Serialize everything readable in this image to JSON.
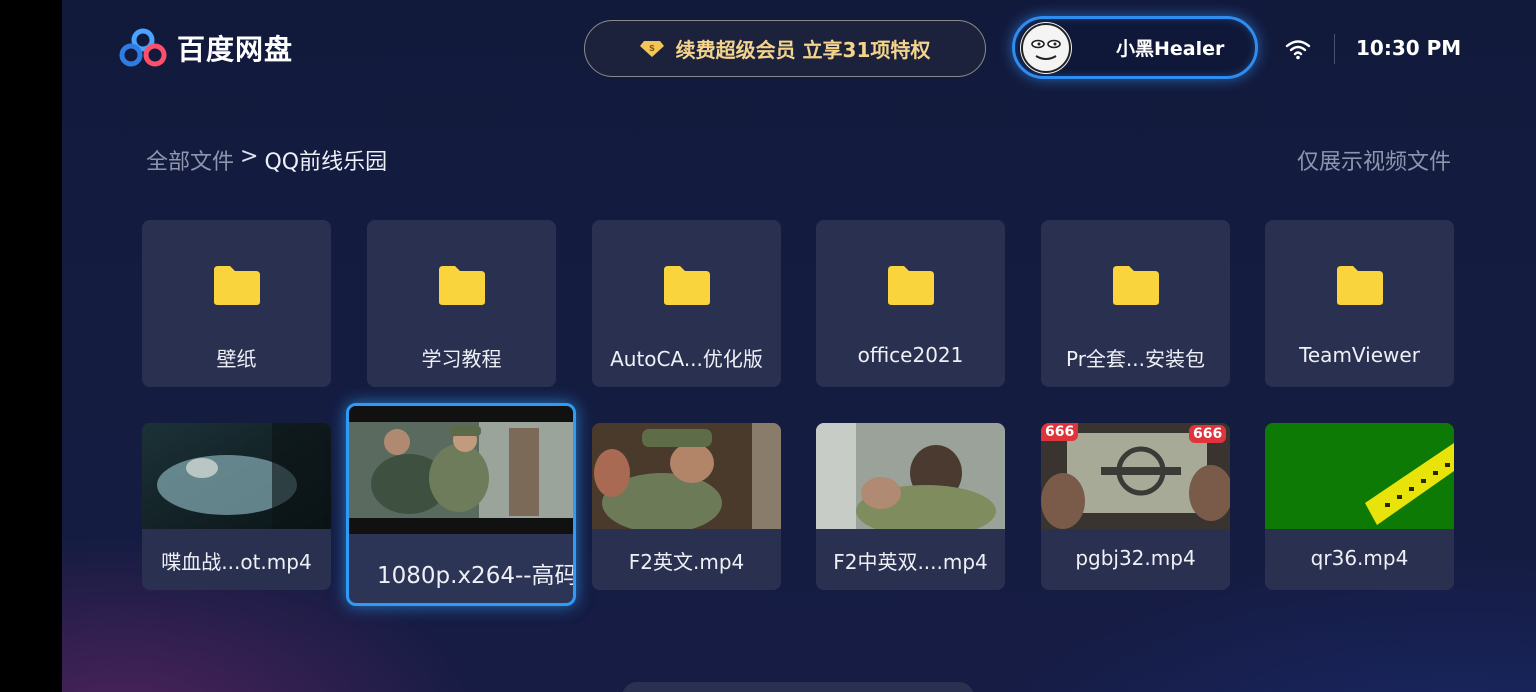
{
  "header": {
    "logo_text": "百度网盘",
    "vip_label": "续费超级会员 立享31项特权",
    "user_name": "小黑Healer",
    "time": "10:30 PM"
  },
  "breadcrumb": {
    "root": "全部文件",
    "separator": ">",
    "current": "QQ前线乐园"
  },
  "filter_label": "仅展示视频文件",
  "folders": [
    {
      "label": "壁纸"
    },
    {
      "label": "学习教程"
    },
    {
      "label": "AutoCA...优化版"
    },
    {
      "label": "office2021"
    },
    {
      "label": "Pr全套...安装包"
    },
    {
      "label": "TeamViewer"
    }
  ],
  "videos": [
    {
      "label": "喋血战...ot.mp4"
    },
    {
      "label": "1080p.x264--高码"
    },
    {
      "label": "F2英文.mp4"
    },
    {
      "label": "F2中英双....mp4"
    },
    {
      "label": "pgbj32.mp4",
      "badge_left": "666",
      "badge_right": "666"
    },
    {
      "label": "qr36.mp4"
    }
  ],
  "colors": {
    "accent": "#2f8df0",
    "vip_text": "#f4d48c",
    "folder": "#f9d43c",
    "tile_bg": "#2a3150"
  },
  "icons": [
    "baidu-netdisk-logo-icon",
    "vip-diamond-icon",
    "wifi-icon",
    "folder-icon"
  ]
}
